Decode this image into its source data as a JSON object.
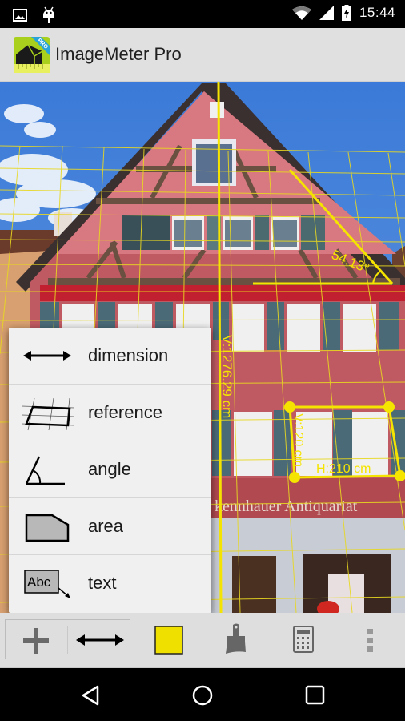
{
  "status_bar": {
    "time": "15:44",
    "icons": [
      "image-notification-icon",
      "android-notification-icon",
      "wifi-icon",
      "signal-icon",
      "battery-charging-icon"
    ]
  },
  "app_bar": {
    "title": "ImageMeter Pro",
    "logo_badge": "PRO"
  },
  "measurements": {
    "vertical_dimension": "V:1276.29 cm",
    "angle": "54.13°",
    "reference_vertical": "V:120 cm",
    "reference_horizontal": "H:210 cm"
  },
  "photo": {
    "shop_sign": "kennhauer Antiquariat"
  },
  "popup_menu": {
    "items": [
      {
        "icon": "dimension-arrow-icon",
        "label": "dimension"
      },
      {
        "icon": "reference-grid-icon",
        "label": "reference"
      },
      {
        "icon": "angle-icon",
        "label": "angle"
      },
      {
        "icon": "area-polygon-icon",
        "label": "area"
      },
      {
        "icon": "text-label-icon",
        "label": "text",
        "icon_text": "Abc"
      }
    ]
  },
  "toolbar": {
    "buttons": [
      {
        "icon": "plus-icon",
        "name": "add"
      },
      {
        "icon": "dimension-arrow-icon",
        "name": "current-tool"
      },
      {
        "icon": "color-swatch-icon",
        "name": "color"
      },
      {
        "icon": "paintbrush-icon",
        "name": "style"
      },
      {
        "icon": "calculator-icon",
        "name": "calculator"
      },
      {
        "icon": "overflow-menu-icon",
        "name": "more"
      }
    ],
    "selected_color": "#f0e000"
  },
  "nav_bar": {
    "buttons": [
      "back-icon",
      "home-icon",
      "recents-icon"
    ]
  },
  "colors": {
    "measure_yellow": "#f5e400",
    "app_bar_bg": "#e0e0e0",
    "menu_bg": "#f0f0f0"
  }
}
